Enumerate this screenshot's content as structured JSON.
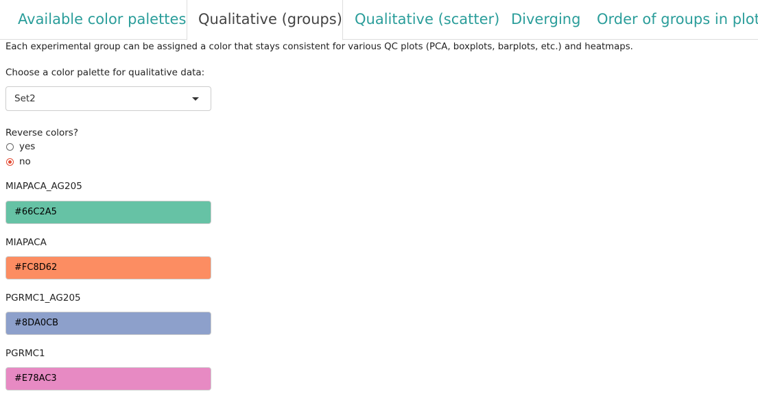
{
  "tabs": [
    {
      "label": "Available color palettes"
    },
    {
      "label": "Qualitative (groups)"
    },
    {
      "label": "Qualitative (scatter)"
    },
    {
      "label": "Diverging"
    },
    {
      "label": "Order of groups in plots"
    }
  ],
  "active_tab": "Qualitative (groups)",
  "description": "Each experimental group can be assigned a color that stays consistent for various QC plots (PCA, boxplots, barplots, etc.) and heatmaps.",
  "palette": {
    "label": "Choose a color palette for qualitative data:",
    "selected": "Set2"
  },
  "reverse": {
    "label": "Reverse colors?",
    "options": [
      {
        "label": "yes",
        "checked": false
      },
      {
        "label": "no",
        "checked": true
      }
    ],
    "accent_color": "#e34a33"
  },
  "groups": [
    {
      "name": "MIAPACA_AG205",
      "color": "#66C2A5"
    },
    {
      "name": "MIAPACA",
      "color": "#FC8D62"
    },
    {
      "name": "PGRMC1_AG205",
      "color": "#8DA0CB"
    },
    {
      "name": "PGRMC1",
      "color": "#E78AC3"
    }
  ],
  "theme": {
    "tab_link_color": "#2a9d9a"
  }
}
